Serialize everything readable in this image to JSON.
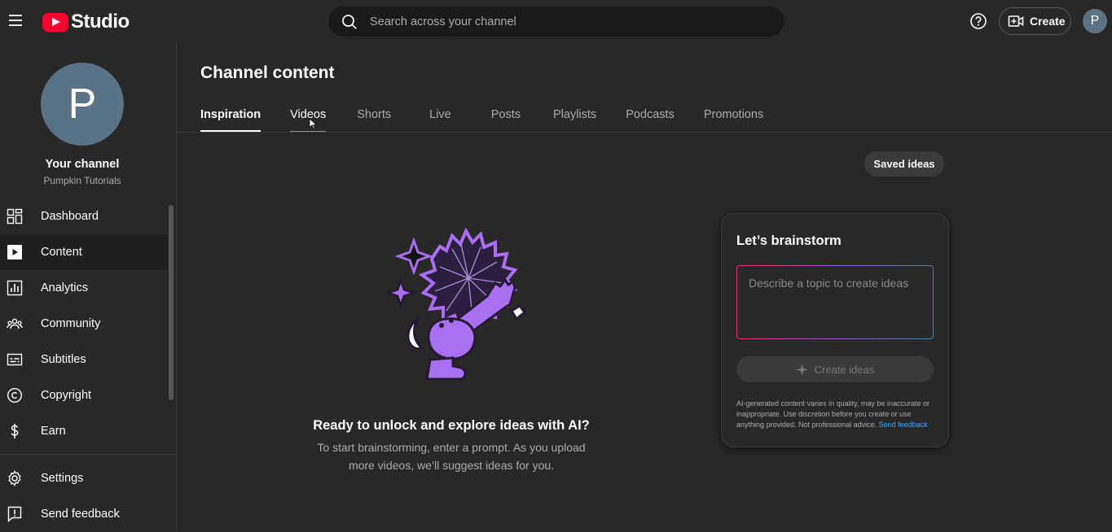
{
  "header": {
    "logo_text": "Studio",
    "search_placeholder": "Search across your channel",
    "create_label": "Create",
    "avatar_letter": "P"
  },
  "sidebar": {
    "avatar_letter": "P",
    "channel_name": "Your channel",
    "channel_handle": "Pumpkin Tutorials",
    "items": [
      {
        "label": "Dashboard",
        "icon": "dashboard-icon"
      },
      {
        "label": "Content",
        "icon": "content-icon",
        "active": true
      },
      {
        "label": "Analytics",
        "icon": "analytics-icon"
      },
      {
        "label": "Community",
        "icon": "community-icon"
      },
      {
        "label": "Subtitles",
        "icon": "subtitles-icon"
      },
      {
        "label": "Copyright",
        "icon": "copyright-icon"
      },
      {
        "label": "Earn",
        "icon": "earn-icon"
      }
    ],
    "bottom_items": [
      {
        "label": "Settings",
        "icon": "gear-icon"
      },
      {
        "label": "Send feedback",
        "icon": "feedback-icon"
      }
    ]
  },
  "main": {
    "title": "Channel content",
    "tabs": [
      {
        "label": "Inspiration",
        "active": true
      },
      {
        "label": "Videos"
      },
      {
        "label": "Shorts"
      },
      {
        "label": "Live"
      },
      {
        "label": "Posts"
      },
      {
        "label": "Playlists"
      },
      {
        "label": "Podcasts"
      },
      {
        "label": "Promotions"
      }
    ],
    "saved_ideas_label": "Saved ideas",
    "hero_title": "Ready to unlock and explore ideas with AI?",
    "hero_subtitle_line1": "To start brainstorming, enter a prompt. As you upload",
    "hero_subtitle_line2": "more videos, we’ll suggest ideas for you."
  },
  "brainstorm": {
    "title": "Let’s brainstorm",
    "prompt_placeholder": "Describe a topic to create ideas",
    "prompt_value": "",
    "create_ideas_label": "Create ideas",
    "disclaimer": "AI-generated content varies in quality, may be inaccurate or inappropriate. Use discretion before you create or use anything provided. Not professional advice.",
    "feedback_link": "Send feedback"
  },
  "colors": {
    "background": "#282828",
    "brand_red": "#ff0033",
    "link_blue": "#3ea6ff",
    "avatar": "#5b7184",
    "illustration_purple": "#a86ff0"
  }
}
